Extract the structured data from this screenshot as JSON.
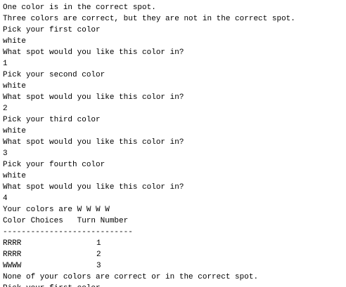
{
  "console": {
    "lines_before_table": [
      "One color is in the correct spot.",
      "Three colors are correct, but they are not in the correct spot.",
      "Pick your first color",
      "white",
      "What spot would you like this color in?",
      "1",
      "Pick your second color",
      "white",
      "What spot would you like this color in?",
      "2",
      "Pick your third color",
      "white",
      "What spot would you like this color in?",
      "3",
      "Pick your fourth color",
      "white",
      "What spot would you like this color in?",
      "4",
      "Your colors are W W W W",
      "Color Choices   Turn Number",
      "----------------------------"
    ],
    "table_rows": [
      {
        "choice": "RRRR",
        "turn": "1"
      },
      {
        "choice": "RRRR",
        "turn": "2"
      },
      {
        "choice": "WWWW",
        "turn": "3"
      }
    ],
    "lines_after_table": [
      "None of your colors are correct or in the correct spot.",
      "Pick your first color"
    ]
  }
}
